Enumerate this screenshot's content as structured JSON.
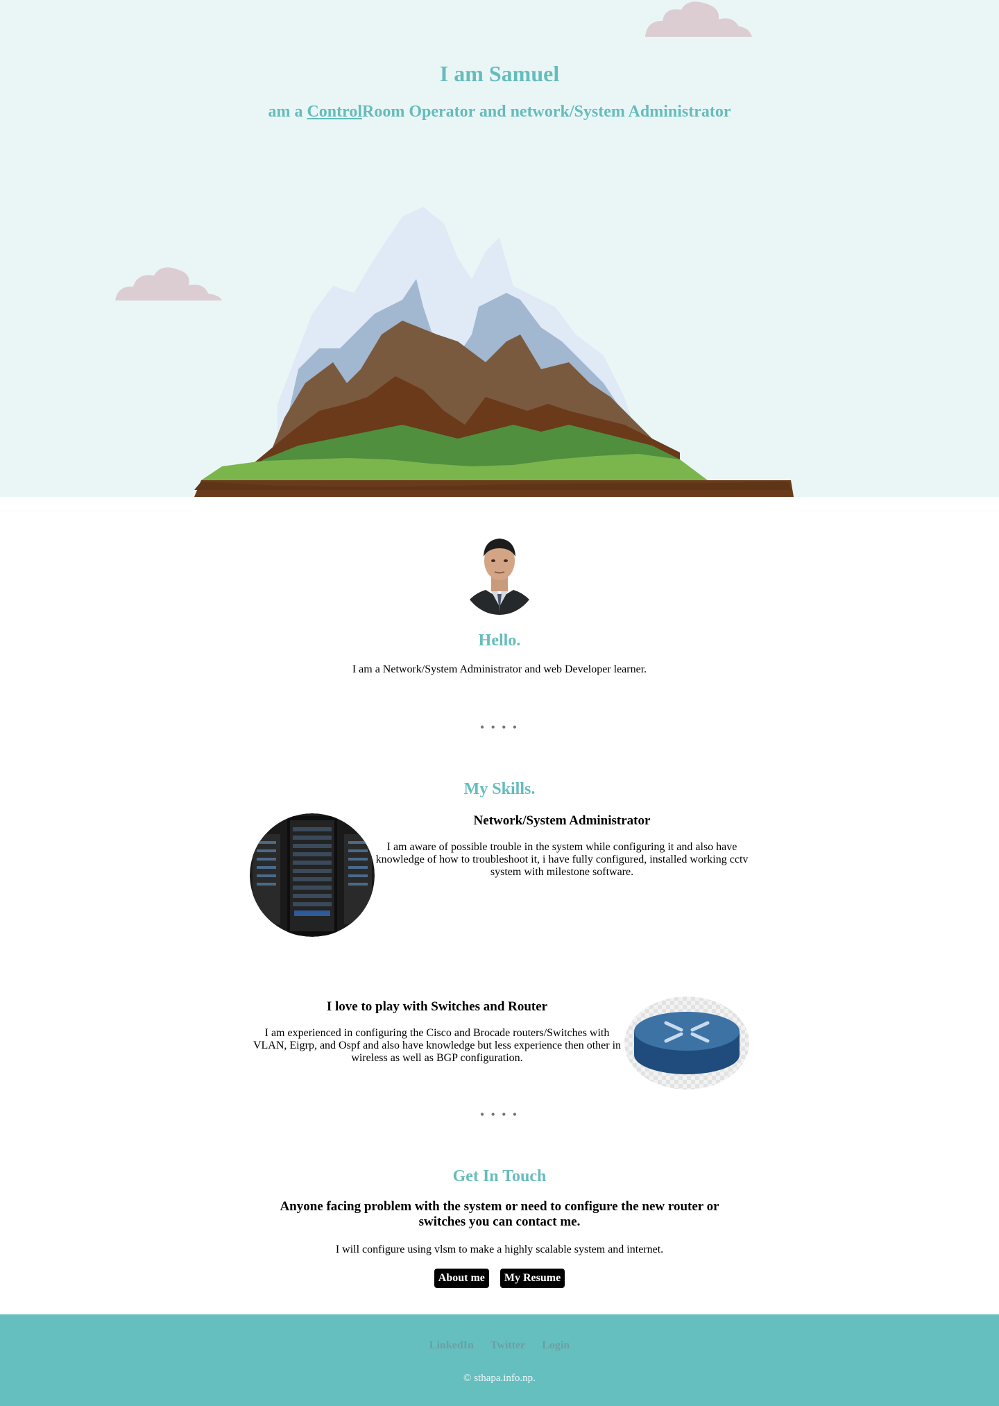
{
  "hero": {
    "title": "I am Samuel",
    "subtitle_prefix": "am a ",
    "subtitle_link": "Control",
    "subtitle_suffix": "Room Operator and network/System Administrator"
  },
  "about": {
    "heading": "Hello.",
    "text": "I am a Network/System Administrator and web Developer learner."
  },
  "divider": "• • • •",
  "skills": {
    "heading": "My Skills.",
    "items": [
      {
        "title": "Network/System Administrator",
        "text": "I am aware of possible trouble in the system while configuring it and also have knowledge of how to troubleshoot it, i have fully configured, installed working cctv system with milestone software.",
        "icon": "server-rack-image"
      },
      {
        "title": "I love to play with Switches and Router",
        "text": "I am experienced in configuring the Cisco and Brocade routers/Switches with VLAN, Eigrp, and Ospf and also have knowledge but less experience then other in wireless as well as BGP configuration.",
        "icon": "router-image"
      }
    ]
  },
  "contact": {
    "heading": "Get In Touch",
    "subheading": "Anyone facing problem with the system or need to configure the new router or switches you can contact me.",
    "text": "I will configure using vlsm to make a highly scalable system and internet.",
    "buttons": [
      "About me",
      "My Resume"
    ]
  },
  "footer": {
    "links": [
      "LinkedIn",
      "Twitter",
      "Login"
    ],
    "copyright": "© sthapa.info.np."
  },
  "colors": {
    "accent": "#66bcbc",
    "hero_bg": "#eaf6f6",
    "footer_bg": "#66bfbf"
  }
}
